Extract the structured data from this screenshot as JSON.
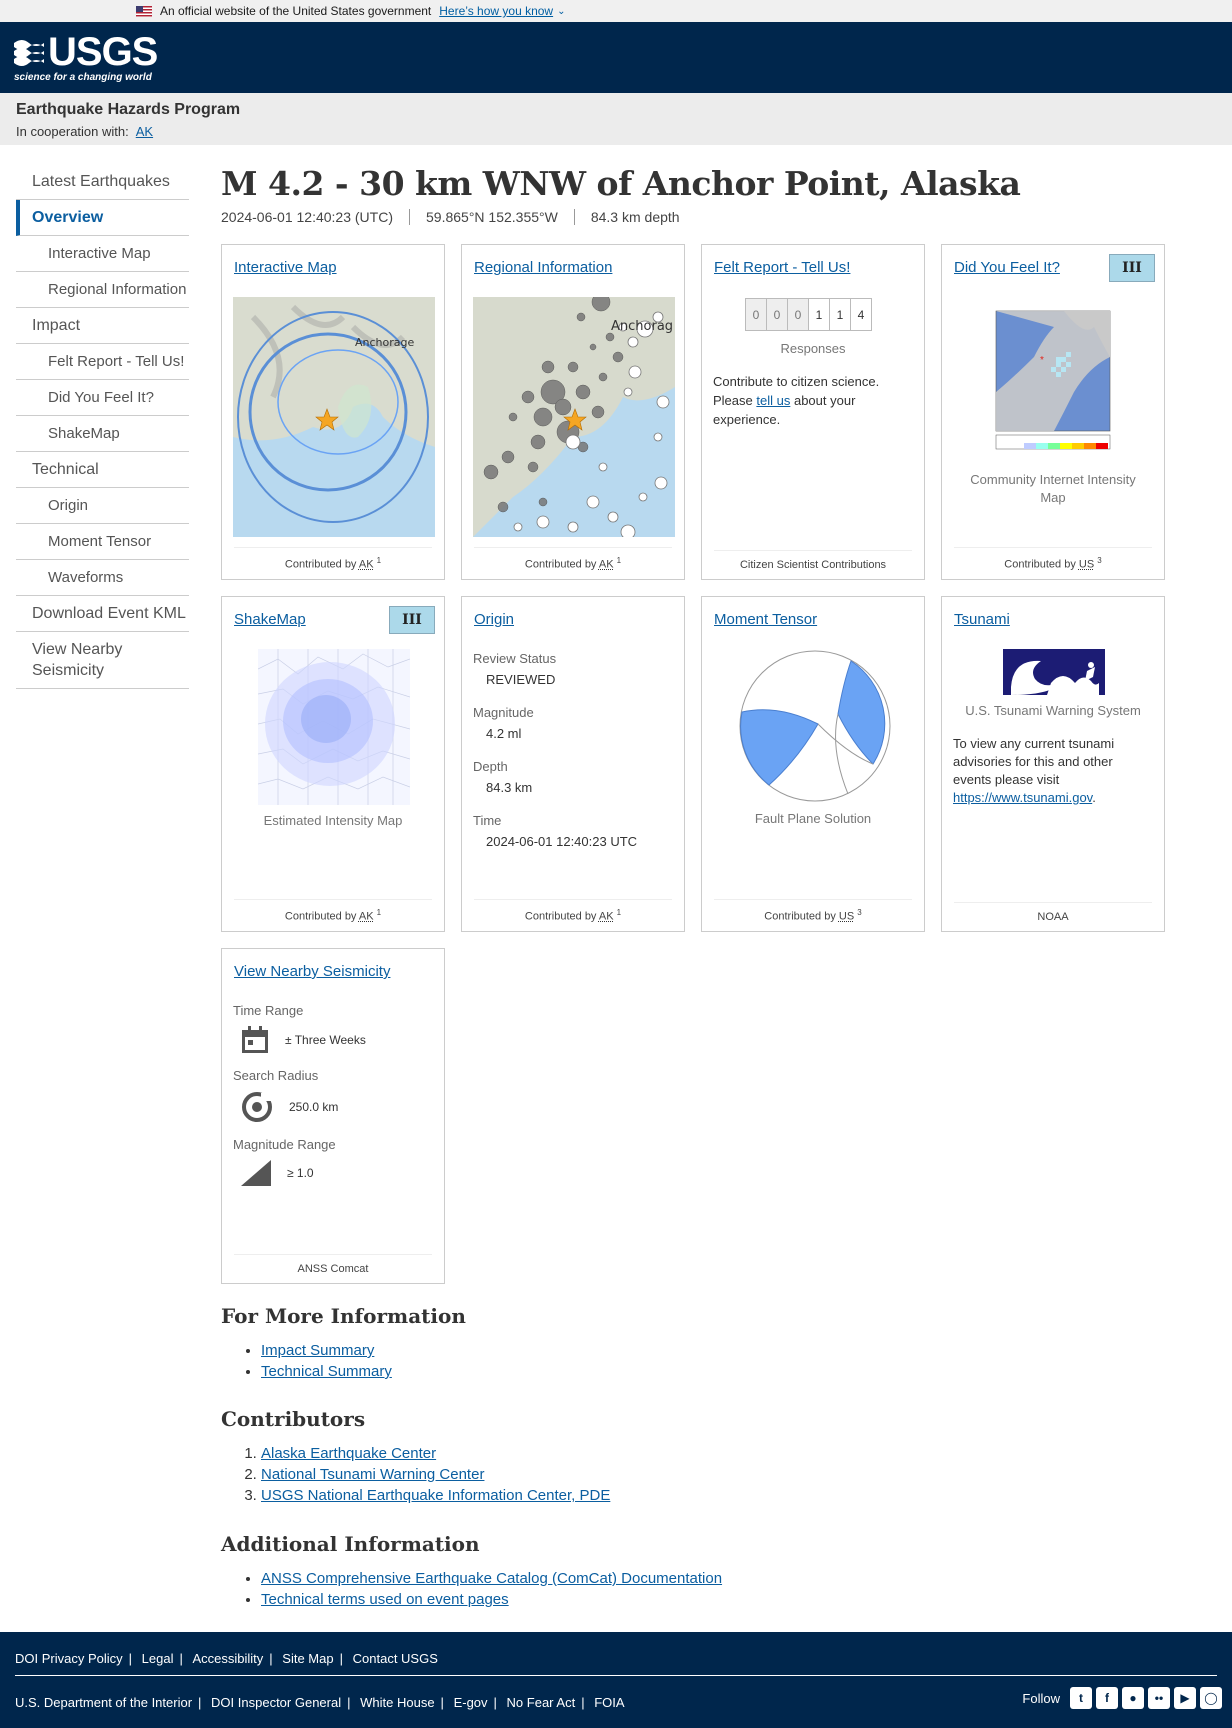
{
  "gov_banner": {
    "text": "An official website of the United States government",
    "link": "Here’s how you know"
  },
  "logo": {
    "wordmark": "USGS",
    "tagline": "science for a changing world"
  },
  "program": {
    "title": "Earthquake Hazards Program",
    "coop_label": "In cooperation with:",
    "coop_link": "AK"
  },
  "sidebar": {
    "items": [
      {
        "label": "Latest Earthquakes"
      },
      {
        "label": "Overview"
      },
      {
        "label": "Interactive Map"
      },
      {
        "label": "Regional Information"
      },
      {
        "label": "Impact"
      },
      {
        "label": "Felt Report - Tell Us!"
      },
      {
        "label": "Did You Feel It?"
      },
      {
        "label": "ShakeMap"
      },
      {
        "label": "Technical"
      },
      {
        "label": "Origin"
      },
      {
        "label": "Moment Tensor"
      },
      {
        "label": "Waveforms"
      },
      {
        "label": "Download Event KML"
      },
      {
        "label": "View Nearby Seismicity"
      }
    ]
  },
  "event": {
    "title": "M 4.2 - 30 km WNW of Anchor Point, Alaska",
    "time": "2024-06-01 12:40:23 (UTC)",
    "location": "59.865°N 152.355°W",
    "depth": "84.3 km depth"
  },
  "cards": {
    "interactive_map": {
      "title": "Interactive Map",
      "place": "Anchorage",
      "foot_prefix": "Contributed by",
      "foot_abbr": "AK",
      "foot_sup": "1"
    },
    "regional": {
      "title": "Regional Information",
      "place": "Anchorag",
      "foot_prefix": "Contributed by",
      "foot_abbr": "AK",
      "foot_sup": "1"
    },
    "felt": {
      "title": "Felt Report - Tell Us!",
      "digits": [
        "0",
        "0",
        "0",
        "1",
        "1",
        "4"
      ],
      "responses": "Responses",
      "text1": "Contribute to citizen science. Please",
      "link": "tell us",
      "text2": "about your experience.",
      "foot": "Citizen Scientist Contributions"
    },
    "dyfi": {
      "title": "Did You Feel It?",
      "badge": "III",
      "caption": "Community Internet Intensity Map",
      "foot_prefix": "Contributed by",
      "foot_abbr": "US",
      "foot_sup": "3"
    },
    "shakemap": {
      "title": "ShakeMap",
      "badge": "III",
      "caption": "Estimated Intensity Map",
      "foot_prefix": "Contributed by",
      "foot_abbr": "AK",
      "foot_sup": "1"
    },
    "origin": {
      "title": "Origin",
      "fields": [
        {
          "label": "Review Status",
          "value": "REVIEWED"
        },
        {
          "label": "Magnitude",
          "value": "4.2 ml"
        },
        {
          "label": "Depth",
          "value": "84.3 km"
        },
        {
          "label": "Time",
          "value": "2024-06-01 12:40:23 UTC"
        }
      ],
      "foot_prefix": "Contributed by",
      "foot_abbr": "AK",
      "foot_sup": "1"
    },
    "moment_tensor": {
      "title": "Moment Tensor",
      "caption": "Fault Plane Solution",
      "foot_prefix": "Contributed by",
      "foot_abbr": "US",
      "foot_sup": "3"
    },
    "tsunami": {
      "title": "Tsunami",
      "caption": "U.S. Tsunami Warning System",
      "text": "To view any current tsunami advisories for this and other events please visit",
      "link": "https://www.tsunami.gov",
      "period": ".",
      "foot": "NOAA"
    },
    "nearby": {
      "title": "View Nearby Seismicity",
      "time_label": "Time Range",
      "time_value": "± Three Weeks",
      "radius_label": "Search Radius",
      "radius_value": "250.0 km",
      "mag_label": "Magnitude Range",
      "mag_value": "≥ 1.0",
      "foot": "ANSS Comcat"
    }
  },
  "more_info": {
    "heading": "For More Information",
    "links": [
      "Impact Summary",
      "Technical Summary"
    ]
  },
  "contributors": {
    "heading": "Contributors",
    "links": [
      "Alaska Earthquake Center",
      "National Tsunami Warning Center",
      "USGS National Earthquake Information Center, PDE"
    ]
  },
  "additional": {
    "heading": "Additional Information",
    "links": [
      "ANSS Comprehensive Earthquake Catalog (ComCat) Documentation",
      "Technical terms used on event pages"
    ]
  },
  "footer": {
    "row1": [
      "DOI Privacy Policy",
      "Legal",
      "Accessibility",
      "Site Map",
      "Contact USGS"
    ],
    "row2": [
      "U.S. Department of the Interior",
      "DOI Inspector General",
      "White House",
      "E-gov",
      "No Fear Act",
      "FOIA"
    ],
    "follow": "Follow",
    "social": [
      "twitter-icon",
      "facebook-icon",
      "github-icon",
      "flickr-icon",
      "youtube-icon",
      "instagram-icon"
    ]
  },
  "colors": {
    "navy": "#00264c",
    "link": "#0b5ea0",
    "badge": "#acd9ea",
    "mt_fill": "#6aa3f4"
  }
}
